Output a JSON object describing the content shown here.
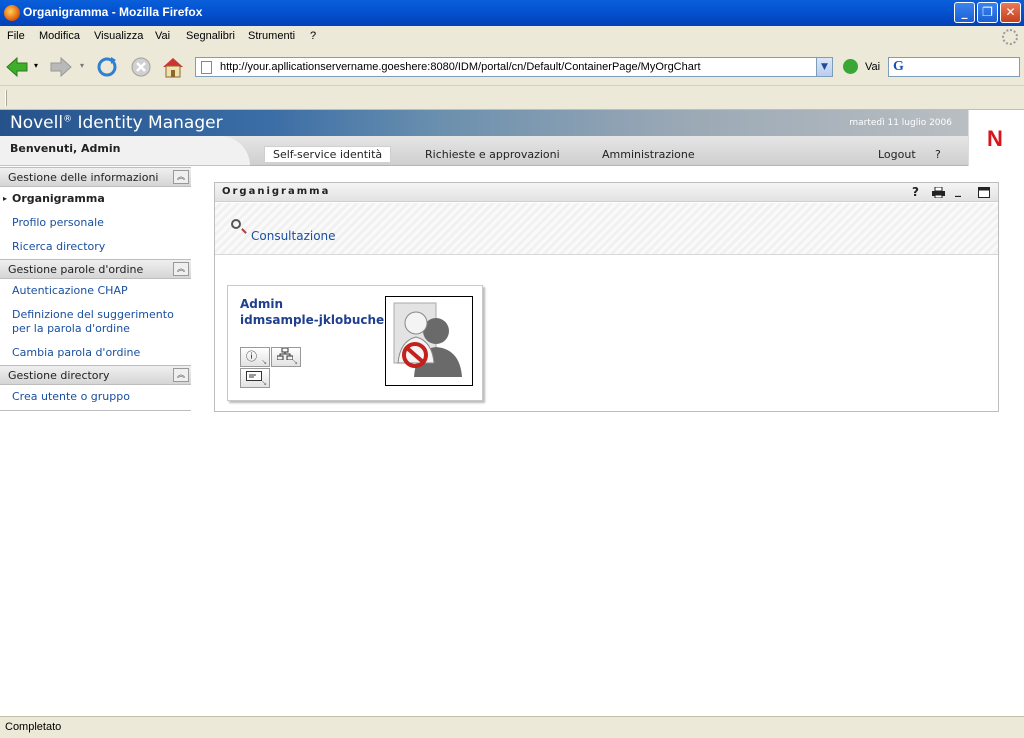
{
  "window": {
    "title": "Organigramma - Mozilla Firefox"
  },
  "menu": [
    "File",
    "Modifica",
    "Visualizza",
    "Vai",
    "Segnalibri",
    "Strumenti",
    "?"
  ],
  "toolbar": {
    "url": "http://your.apllicationservername.goeshere:8080/IDM/portal/cn/Default/ContainerPage/MyOrgChart",
    "go_label": "Vai"
  },
  "app": {
    "brand": "Novell",
    "brand_reg": "®",
    "product": "Identity Manager",
    "date": "martedì 11 luglio 2006",
    "welcome": "Benvenuti, Admin",
    "logo_letter": "N",
    "tabs": [
      "Self-service identità",
      "Richieste e approvazioni",
      "Amministrazione"
    ],
    "logout": "Logout",
    "help": "?"
  },
  "sidebar": {
    "groups": [
      {
        "title": "Gestione delle informazioni",
        "items": [
          "Organigramma",
          "Profilo personale",
          "Ricerca directory"
        ]
      },
      {
        "title": "Gestione parole d'ordine",
        "items": [
          "Autenticazione CHAP",
          "Definizione del suggerimento per la parola d'ordine",
          "Cambia parola d'ordine"
        ]
      },
      {
        "title": "Gestione directory",
        "items": [
          "Crea utente o gruppo"
        ]
      }
    ]
  },
  "portlet": {
    "title": "Organigramma",
    "lookup_label": "Consultazione",
    "card": {
      "name": "Admin",
      "user_id": "idmsample-jklobucher"
    }
  },
  "status": {
    "text": "Completato"
  }
}
